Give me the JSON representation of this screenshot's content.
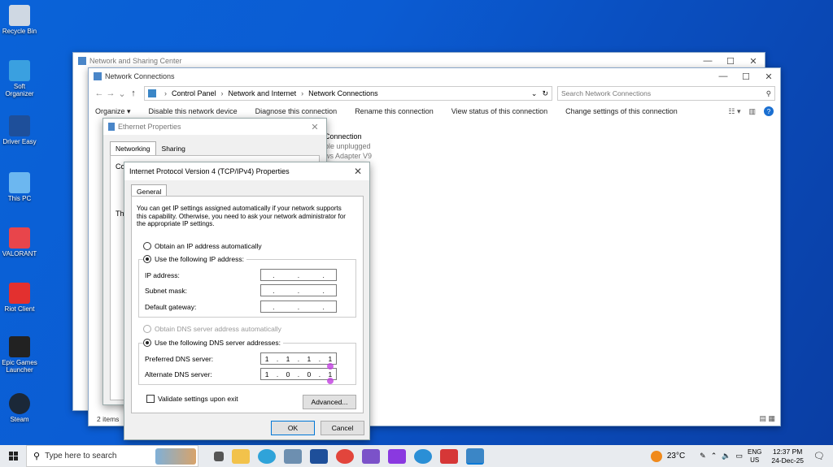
{
  "desktop": {
    "icons": [
      {
        "label": "Recycle Bin",
        "color": "#cfd8e3"
      },
      {
        "label": "Soft Organizer",
        "color": "#3aa0e0"
      },
      {
        "label": "Driver Easy",
        "color": "#1e4f9a"
      },
      {
        "label": "This PC",
        "color": "#6cb7f0"
      },
      {
        "label": "VALORANT",
        "color": "#e8454b"
      },
      {
        "label": "Riot Client",
        "color": "#e3302f"
      },
      {
        "label": "Epic Games Launcher",
        "color": "#222222"
      },
      {
        "label": "Steam",
        "color": "#1b2838"
      }
    ]
  },
  "sharing_center": {
    "title": "Network and Sharing Center"
  },
  "net_conn": {
    "title": "Network Connections",
    "breadcrumb": [
      "Control Panel",
      "Network and Internet",
      "Network Connections"
    ],
    "search_placeholder": "Search Network Connections",
    "commands": [
      "Organize ▾",
      "Disable this network device",
      "Diagnose this connection",
      "Rename this connection",
      "View status of this connection",
      "Change settings of this connection"
    ],
    "item": {
      "name": "Connection",
      "status": "ble unplugged",
      "adapter": "ws Adapter V9"
    },
    "status_bar": "2 items"
  },
  "eth_props": {
    "title": "Ethernet Properties",
    "tabs": [
      "Networking",
      "Sharing"
    ],
    "connect_prefix": "Co",
    "this_prefix": "Th"
  },
  "ipv4": {
    "title": "Internet Protocol Version 4 (TCP/IPv4) Properties",
    "tab": "General",
    "intro": "You can get IP settings assigned automatically if your network supports this capability. Otherwise, you need to ask your network administrator for the appropriate IP settings.",
    "obtain_ip": "Obtain an IP address automatically",
    "use_ip": "Use the following IP address:",
    "ip_label": "IP address:",
    "subnet_label": "Subnet mask:",
    "gateway_label": "Default gateway:",
    "obtain_dns": "Obtain DNS server address automatically",
    "use_dns": "Use the following DNS server addresses:",
    "preferred_label": "Preferred DNS server:",
    "alternate_label": "Alternate DNS server:",
    "preferred_dns": [
      "1",
      "1",
      "1",
      "1"
    ],
    "alternate_dns": [
      "1",
      "0",
      "0",
      "1"
    ],
    "validate": "Validate settings upon exit",
    "advanced": "Advanced...",
    "ok": "OK",
    "cancel": "Cancel"
  },
  "taskbar": {
    "search_placeholder": "Type here to search",
    "weather": "23°C",
    "lang_top": "ENG",
    "lang_bottom": "US",
    "time": "12:37 PM",
    "date": "24-Dec-25",
    "apps": [
      {
        "name": "task-view-icon",
        "color": "#555555"
      },
      {
        "name": "file-explorer-icon",
        "color": "#f2c24b"
      },
      {
        "name": "edge-icon",
        "color": "#2fa3d9"
      },
      {
        "name": "notepad-icon",
        "color": "#6d8fb0"
      },
      {
        "name": "driver-easy-icon",
        "color": "#1e4f9a"
      },
      {
        "name": "chrome-icon",
        "color": "#e2453c"
      },
      {
        "name": "app-badge-icon",
        "color": "#7b52c9"
      },
      {
        "name": "clipchamp-icon",
        "color": "#8a39e0"
      },
      {
        "name": "ccleaner-icon",
        "color": "#2a8fd6"
      },
      {
        "name": "video-app-icon",
        "color": "#d63737"
      },
      {
        "name": "control-panel-icon",
        "color": "#3b86c6"
      }
    ]
  }
}
